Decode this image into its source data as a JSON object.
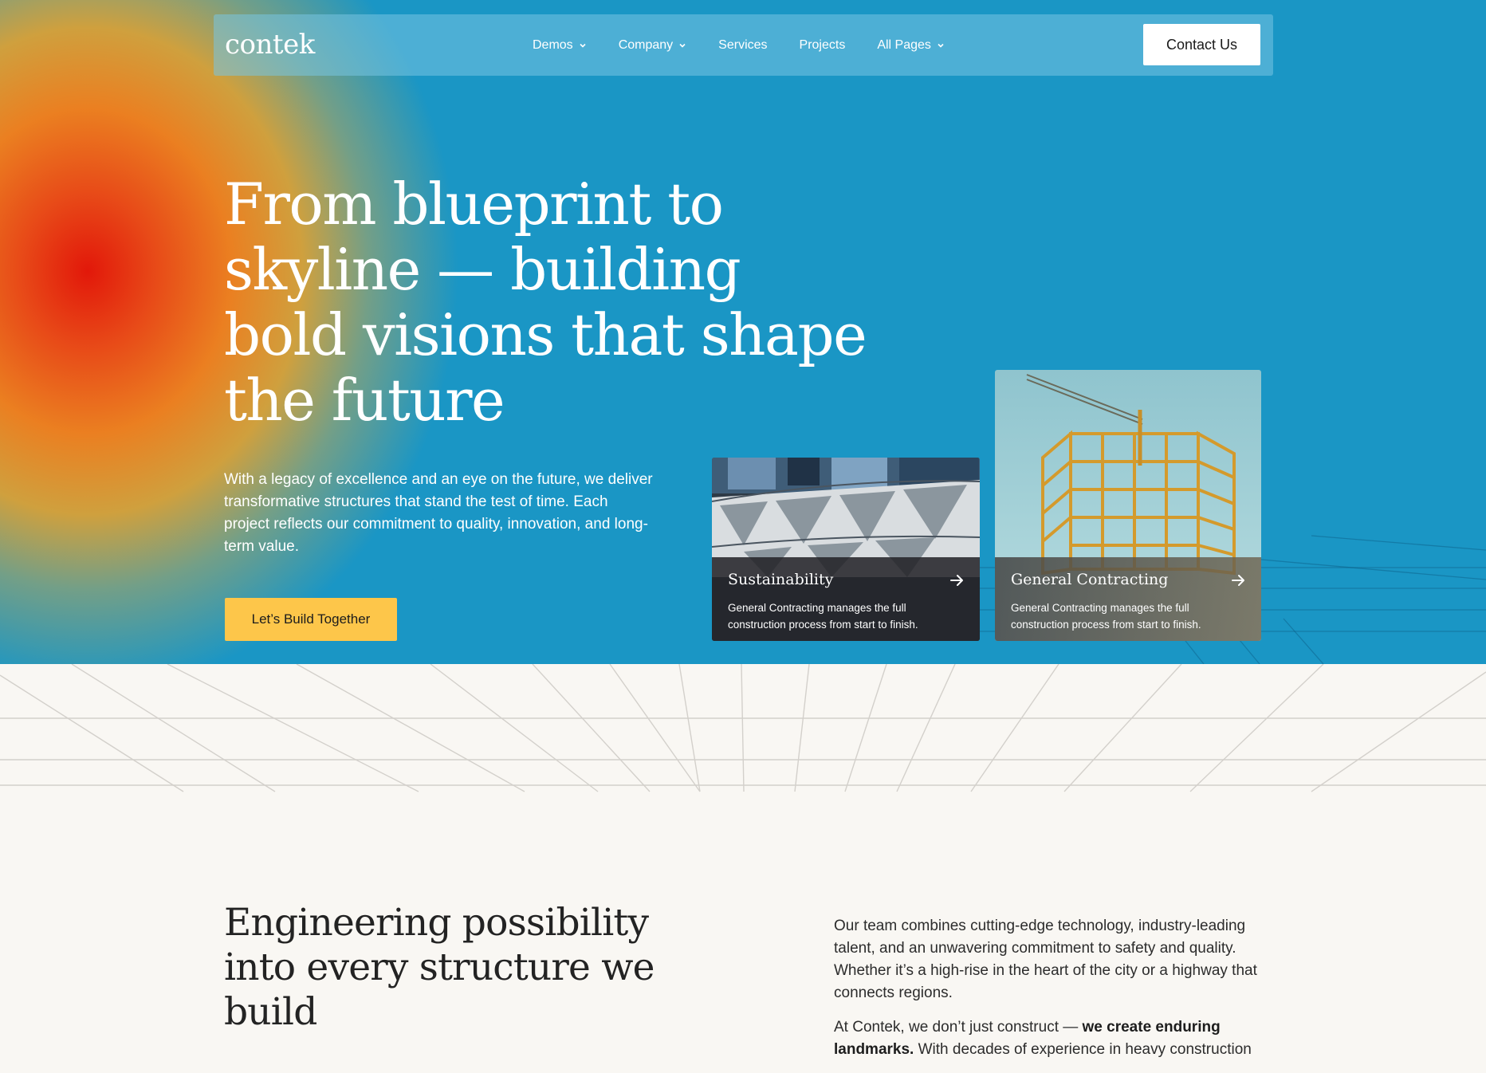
{
  "nav": {
    "logo": "contek",
    "items": [
      {
        "label": "Demos",
        "dropdown": true
      },
      {
        "label": "Company",
        "dropdown": true
      },
      {
        "label": "Services",
        "dropdown": false
      },
      {
        "label": "Projects",
        "dropdown": false
      },
      {
        "label": "All Pages",
        "dropdown": true
      }
    ],
    "contact_label": "Contact Us"
  },
  "hero": {
    "title": "From blueprint to skyline — building bold visions that shape the future",
    "text": "With a legacy of excellence and an eye on the future, we deliver transformative structures that stand the test of time. Each project reflects our commitment to quality, innovation, and long-term value.",
    "cta_label": "Let’s Build Together"
  },
  "cards": [
    {
      "title": "Sustainability",
      "description": "General Contracting manages the full construction process from start to finish.",
      "icon": "arrow-right-icon"
    },
    {
      "title": "General Contracting",
      "description": "General Contracting manages the full construction process from start to finish.",
      "icon": "arrow-right-icon"
    }
  ],
  "about": {
    "title": "Engineering possibility into every structure we build",
    "paragraph1": "Our team combines cutting-edge technology, industry-leading talent, and an unwavering commitment to safety and quality. Whether it’s a high-rise in the heart of the city or a highway that connects regions.",
    "paragraph2_start": "At Contek, we don’t just construct — ",
    "paragraph2_bold": "we create enduring landmarks.",
    "paragraph2_end": " With decades of experience in heavy construction"
  },
  "colors": {
    "hero_blue": "#1a96c5",
    "cta_yellow": "#fdc64a",
    "page_bg": "#f9f7f3",
    "glow_red": "#e2180a",
    "glow_orange": "#f7a220"
  }
}
